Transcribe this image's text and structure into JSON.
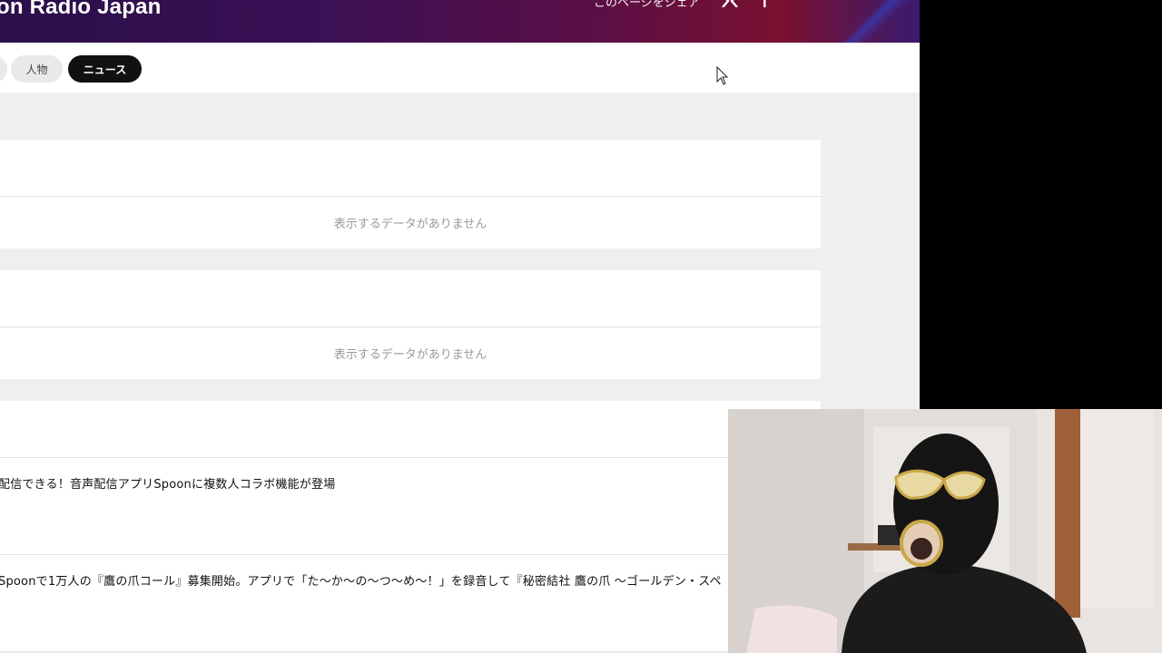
{
  "header": {
    "brand_title": "on Radio Japan",
    "share_label": "このページをシェア",
    "social": [
      {
        "icon": "x-logo-icon"
      },
      {
        "icon": "facebook-icon"
      }
    ]
  },
  "tabs": [
    {
      "label": "人物",
      "active": false
    },
    {
      "label": "ニュース",
      "active": true
    }
  ],
  "sections": [
    {
      "empty_message": "表示するデータがありません"
    },
    {
      "empty_message": "表示するデータがありません"
    }
  ],
  "news": [
    {
      "title": "配信できる！音声配信アプリSpoonに複数人コラボ機能が登場"
    },
    {
      "title": "Spoonで1万人の『鷹の爪コール』募集開始。アプリで「た〜か〜の〜つ〜め〜！」を録音して『秘密結社 鷹の爪 〜ゴールデン・スペ"
    }
  ],
  "colors": {
    "page_bg": "#efefef",
    "card_bg": "#ffffff",
    "active_tab_bg": "#111111",
    "header_gradient_start": "#2a0f4a",
    "header_gradient_end": "#7a1030"
  }
}
